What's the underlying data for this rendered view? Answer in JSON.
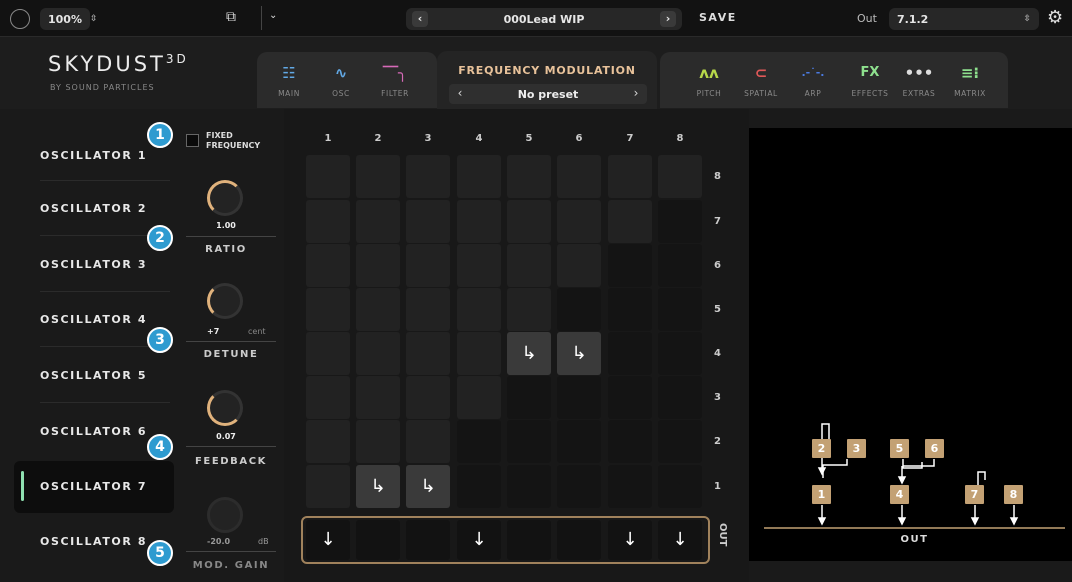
{
  "topbar": {
    "zoom": "100%",
    "preset_name": "000Lead WIP",
    "save_label": "SAVE",
    "out_label": "Out",
    "out_value": "7.1.2"
  },
  "logo": {
    "name": "SKYDUST",
    "suffix": "3D",
    "byline": "BY SOUND PARTICLES"
  },
  "tabs_left": [
    {
      "label": "MAIN",
      "icon": "grid-icon"
    },
    {
      "label": "OSC",
      "icon": "wave-icon"
    },
    {
      "label": "FILTER",
      "icon": "filter-icon"
    }
  ],
  "fm": {
    "title": "FREQUENCY MODULATION",
    "preset": "No preset"
  },
  "tabs_right": [
    {
      "label": "PITCH",
      "icon": "pitch-icon"
    },
    {
      "label": "SPATIAL",
      "icon": "spatial-icon"
    },
    {
      "label": "ARP",
      "icon": "arp-icon"
    },
    {
      "label": "EFFECTS",
      "icon": "FX"
    },
    {
      "label": "EXTRAS",
      "icon": "•••"
    },
    {
      "label": "MATRIX",
      "icon": "matrix-icon"
    }
  ],
  "oscillators": [
    "OSCILLATOR 1",
    "OSCILLATOR 2",
    "OSCILLATOR 3",
    "OSCILLATOR 4",
    "OSCILLATOR 5",
    "OSCILLATOR 6",
    "OSCILLATOR 7",
    "OSCILLATOR 8"
  ],
  "selected_oscillator": 7,
  "controls": {
    "fixed_frequency": {
      "label_1": "FIXED",
      "label_2": "FREQUENCY",
      "checked": false
    },
    "ratio": {
      "label": "RATIO",
      "value": "1.00"
    },
    "detune": {
      "label": "DETUNE",
      "value": "+7",
      "unit": "cent"
    },
    "feedback": {
      "label": "FEEDBACK",
      "value": "0.07"
    },
    "mod_gain": {
      "label": "MOD. GAIN",
      "value": "-20.0",
      "unit": "dB"
    }
  },
  "badges": [
    "1",
    "2",
    "3",
    "4",
    "5"
  ],
  "matrix": {
    "columns": [
      "1",
      "2",
      "3",
      "4",
      "5",
      "6",
      "7",
      "8"
    ],
    "rows": [
      "8",
      "7",
      "6",
      "5",
      "4",
      "3",
      "2",
      "1"
    ],
    "routes": [
      {
        "from": "5",
        "to": "4"
      },
      {
        "from": "6",
        "to": "4"
      },
      {
        "from": "2",
        "to": "1"
      },
      {
        "from": "3",
        "to": "1"
      }
    ],
    "out_label": "OUT",
    "out_active": [
      true,
      false,
      false,
      true,
      false,
      false,
      true,
      true
    ]
  },
  "diagram": {
    "out_label": "OUT",
    "nodes": [
      "2",
      "3",
      "5",
      "6",
      "1",
      "4",
      "7",
      "8"
    ]
  },
  "colors": {
    "accent_gold": "#c3a174",
    "badge_blue": "#2e9bd0",
    "selected_green": "#8fe0b0",
    "fm_title": "#e8c29a"
  }
}
